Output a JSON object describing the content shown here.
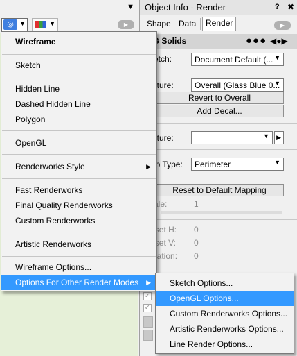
{
  "left_toolbar": {
    "render_mode_icon": "render-mode-icon",
    "palette_icon": "color-palette-icon",
    "top_arrow": "▼",
    "more_label": "▶"
  },
  "object_info": {
    "title": "Object Info - Render",
    "help_label": "?",
    "close_label": "✖",
    "tabs": [
      "Shape",
      "Data",
      "Render"
    ],
    "active_tab": "Render",
    "more_label": "▶",
    "header_title": "CSG Solids",
    "header_dots": "●●●",
    "header_nav": "◀●▶",
    "rows": {
      "sketch_label": "Sketch:",
      "sketch_value": "Document Default (...",
      "overall_label": "Texture:",
      "overall_value": "Overall (Glass Blue 0...",
      "revert_button": "Revert to Overall",
      "add_decal_button": "Add Decal...",
      "texture_label": "Texture:",
      "texture_value": "",
      "map_type_label": "Map Type:",
      "map_type_value": "Perimeter",
      "reset_mapping_button": "Reset to Default Mapping",
      "scale_label": "Scale:",
      "scale_value": "1",
      "offset_h_label": "Offset H:",
      "offset_h_value": "0",
      "offset_v_label": "Offset V:",
      "offset_v_value": "0",
      "rotation_label": "Rotation:",
      "rotation_value": "0"
    }
  },
  "menu": {
    "items": [
      {
        "label": "Wireframe",
        "bold": true
      },
      {
        "label": "Sketch"
      },
      {
        "label": "Hidden Line"
      },
      {
        "label": "Dashed Hidden Line"
      },
      {
        "label": "Polygon"
      },
      {
        "label": "OpenGL"
      },
      {
        "label": "Renderworks Style",
        "submenu": true
      },
      {
        "label": "Fast Renderworks"
      },
      {
        "label": "Final Quality Renderworks"
      },
      {
        "label": "Custom Renderworks"
      },
      {
        "label": "Artistic Renderworks"
      },
      {
        "label": "Wireframe Options..."
      },
      {
        "label": "Options For Other Render Modes",
        "submenu": true,
        "selected": true
      }
    ],
    "submenu_arrow": "▶"
  },
  "submenu": {
    "items": [
      {
        "label": "Sketch Options..."
      },
      {
        "label": "OpenGL Options...",
        "selected": true
      },
      {
        "label": "Custom Renderworks Options..."
      },
      {
        "label": "Artistic Renderworks Options..."
      },
      {
        "label": "Line Render Options..."
      }
    ]
  },
  "colors": {
    "highlight": "#3399ff",
    "canvas": "#e6f0d8"
  }
}
